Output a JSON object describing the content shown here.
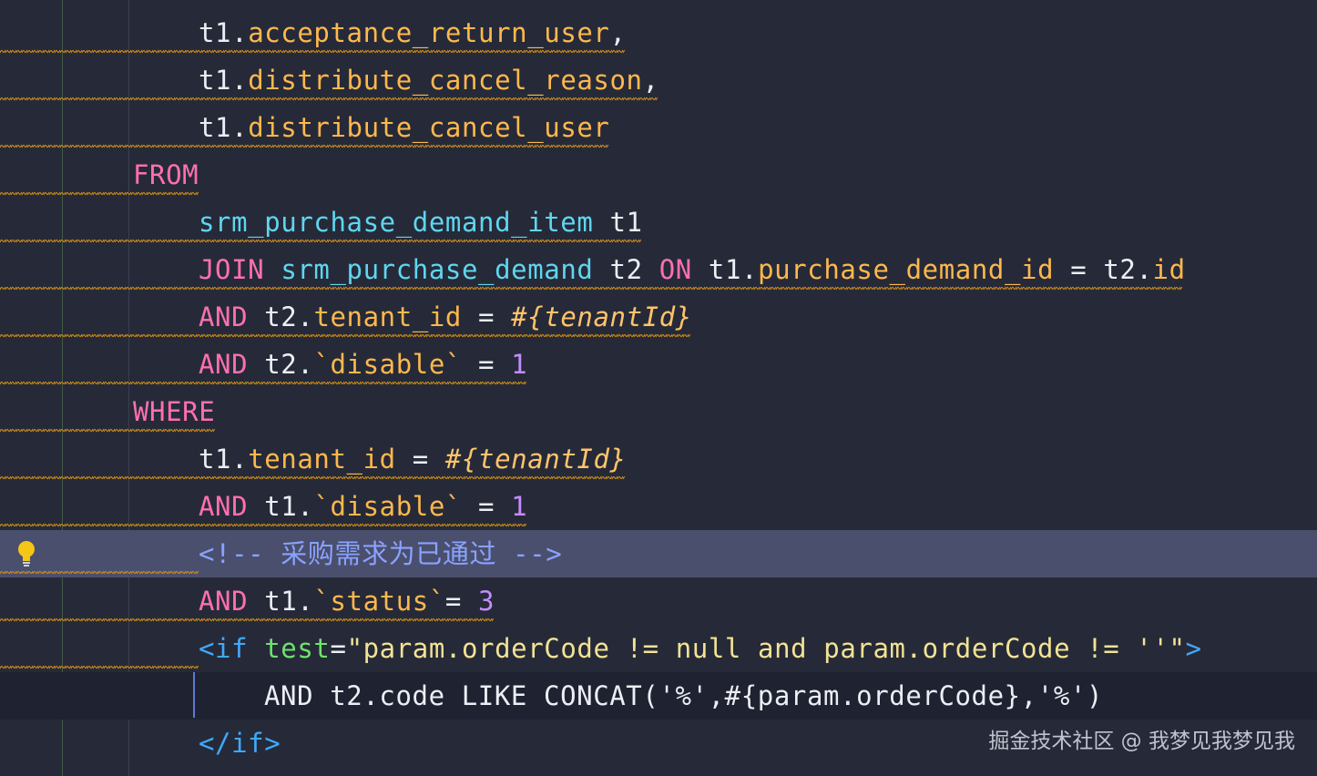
{
  "lines": [
    {
      "tokens": [
        {
          "t": "t1.",
          "c": "plain"
        },
        {
          "t": "acceptance_return_user",
          "c": "col"
        },
        {
          "t": ",",
          "c": "plain"
        }
      ]
    },
    {
      "tokens": [
        {
          "t": "t1.",
          "c": "plain"
        },
        {
          "t": "distribute_cancel_reason",
          "c": "col"
        },
        {
          "t": ",",
          "c": "plain"
        }
      ]
    },
    {
      "tokens": [
        {
          "t": "t1.",
          "c": "plain"
        },
        {
          "t": "distribute_cancel_user",
          "c": "col"
        }
      ]
    },
    {
      "tokens": [
        {
          "t": "FROM",
          "c": "kw"
        }
      ]
    },
    {
      "tokens": [
        {
          "t": "srm_purchase_demand_item",
          "c": "tbl"
        },
        {
          "t": " t1",
          "c": "plain"
        }
      ]
    },
    {
      "tokens": [
        {
          "t": "JOIN",
          "c": "kw"
        },
        {
          "t": " ",
          "c": "plain"
        },
        {
          "t": "srm_purchase_demand",
          "c": "tbl"
        },
        {
          "t": " t2 ",
          "c": "plain"
        },
        {
          "t": "ON",
          "c": "kw"
        },
        {
          "t": " t1.",
          "c": "plain"
        },
        {
          "t": "purchase_demand_id",
          "c": "col"
        },
        {
          "t": " = t2.",
          "c": "plain"
        },
        {
          "t": "id",
          "c": "col"
        }
      ]
    },
    {
      "tokens": [
        {
          "t": "AND",
          "c": "kw"
        },
        {
          "t": " t2.",
          "c": "plain"
        },
        {
          "t": "tenant_id",
          "c": "col"
        },
        {
          "t": " = ",
          "c": "plain"
        },
        {
          "t": "#{tenantId}",
          "c": "tpl"
        }
      ]
    },
    {
      "tokens": [
        {
          "t": "AND",
          "c": "kw"
        },
        {
          "t": " t2.",
          "c": "plain"
        },
        {
          "t": "`disable`",
          "c": "col"
        },
        {
          "t": " = ",
          "c": "plain"
        },
        {
          "t": "1",
          "c": "num"
        }
      ]
    },
    {
      "tokens": [
        {
          "t": "WHERE",
          "c": "kw"
        }
      ]
    },
    {
      "tokens": [
        {
          "t": "t1.",
          "c": "plain"
        },
        {
          "t": "tenant_id",
          "c": "col"
        },
        {
          "t": " = ",
          "c": "plain"
        },
        {
          "t": "#{tenantId}",
          "c": "tpl"
        }
      ]
    },
    {
      "tokens": [
        {
          "t": "AND",
          "c": "kw"
        },
        {
          "t": " t1.",
          "c": "plain"
        },
        {
          "t": "`disable`",
          "c": "col"
        },
        {
          "t": " = ",
          "c": "plain"
        },
        {
          "t": "1",
          "c": "num"
        }
      ]
    },
    {
      "tokens": [
        {
          "t": "<!-- 采购需求为已通过 -->",
          "c": "cmt"
        }
      ]
    },
    {
      "tokens": [
        {
          "t": "AND",
          "c": "kw"
        },
        {
          "t": " t1.",
          "c": "plain"
        },
        {
          "t": "`status`",
          "c": "col"
        },
        {
          "t": "= ",
          "c": "plain"
        },
        {
          "t": "3",
          "c": "num"
        }
      ]
    },
    {
      "tokens": [
        {
          "t": "<if",
          "c": "tag"
        },
        {
          "t": " ",
          "c": "plain"
        },
        {
          "t": "test",
          "c": "attr"
        },
        {
          "t": "=",
          "c": "plain"
        },
        {
          "t": "\"param.orderCode != null and param.orderCode != ''\"",
          "c": "str"
        },
        {
          "t": ">",
          "c": "tag"
        }
      ]
    },
    {
      "tokens": [
        {
          "t": "AND t2.code LIKE CONCAT('%',#{param.orderCode},'%')",
          "c": "plain"
        }
      ]
    },
    {
      "tokens": [
        {
          "t": "</if>",
          "c": "tag"
        }
      ]
    }
  ],
  "watermark": "掘金技术社区 @ 我梦见我梦见我",
  "colors": {
    "background": "#262a38",
    "keyword": "#ff6fb1",
    "column": "#ffb84d",
    "table": "#5fd6f0",
    "number": "#c48cff",
    "comment": "#8aa2ff",
    "xml_tag": "#40a9ff",
    "xml_attr": "#6ee26e",
    "string": "#f2e394",
    "current_line": "#4a4f6d",
    "warning_squiggle": "#c98a18"
  },
  "icons": {
    "intention": "lightbulb-icon"
  }
}
